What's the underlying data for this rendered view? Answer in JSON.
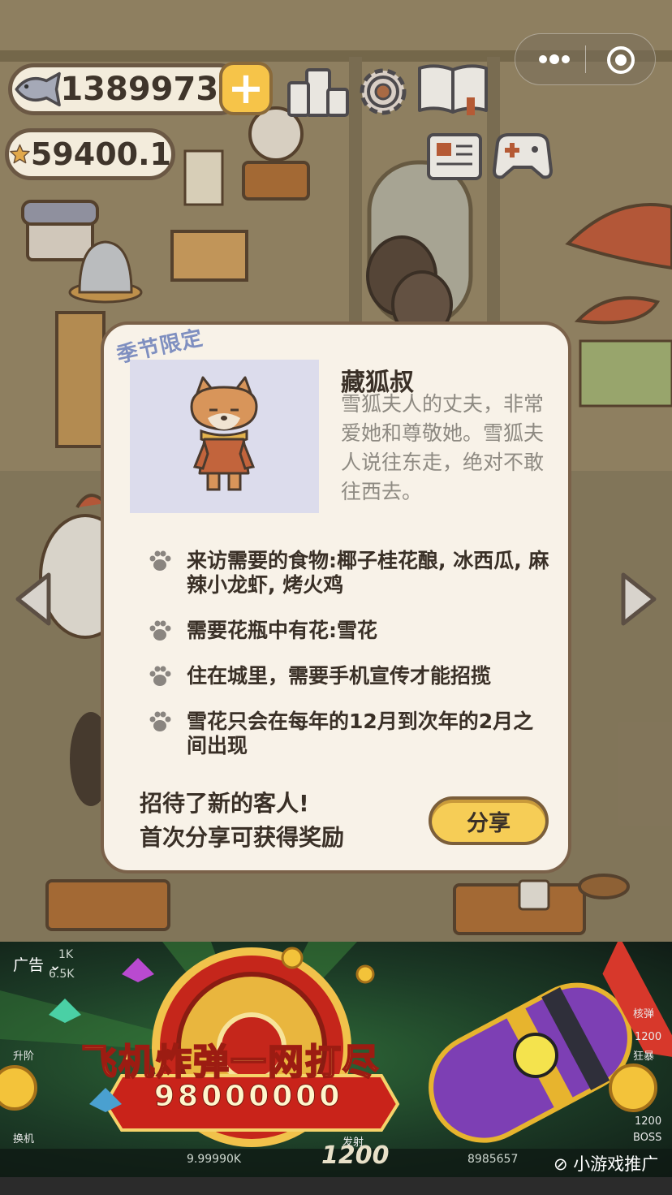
{
  "hud": {
    "fish_coins": "13899736",
    "stars": "59400.1"
  },
  "popup": {
    "season_tag": "季节限定",
    "character": {
      "name": "藏狐叔",
      "description": "雪狐夫人的丈夫，非常爱她和尊敬她。雪狐夫人说往东走，绝对不敢往西去。"
    },
    "requirements": [
      {
        "text": "来访需要的食物:椰子桂花酿, 冰西瓜, 麻辣小龙虾, 烤火鸡"
      },
      {
        "text": "需要花瓶中有花:雪花"
      },
      {
        "text": "住在城里，需要手机宣传才能招揽"
      },
      {
        "text": "雪花只会在每年的12月到次年的2月之间出现"
      }
    ],
    "note_line1": "招待了新的客人!",
    "note_line2": "首次分享可获得奖励",
    "share_label": "分享"
  },
  "ad": {
    "label": "广告",
    "title": "飞机炸弹一网打尽",
    "jackpot": "98000000",
    "promo_text": "小游戏推广",
    "stat_top_1": "1K",
    "stat_top_2": "6.5K",
    "balance": "9.99990K",
    "bet": "1200",
    "score": "8985657",
    "side_labels": [
      "升阶",
      "换机"
    ],
    "right_labels": [
      "核弹",
      "1200",
      "狂暴",
      "1200",
      "BOSS"
    ],
    "fire_label": "发射"
  },
  "icons": {
    "fish": "fish-icon",
    "star": "star-icon",
    "plus": "plus-icon",
    "ranking": "ranking-podium-icon",
    "settings": "gear-icon",
    "book": "book-icon",
    "newspaper": "newspaper-icon",
    "gamepad": "gamepad-icon",
    "shop": "shop-icon",
    "more": "more-dots-icon",
    "close": "target-close-icon",
    "paw": "paw-icon"
  }
}
